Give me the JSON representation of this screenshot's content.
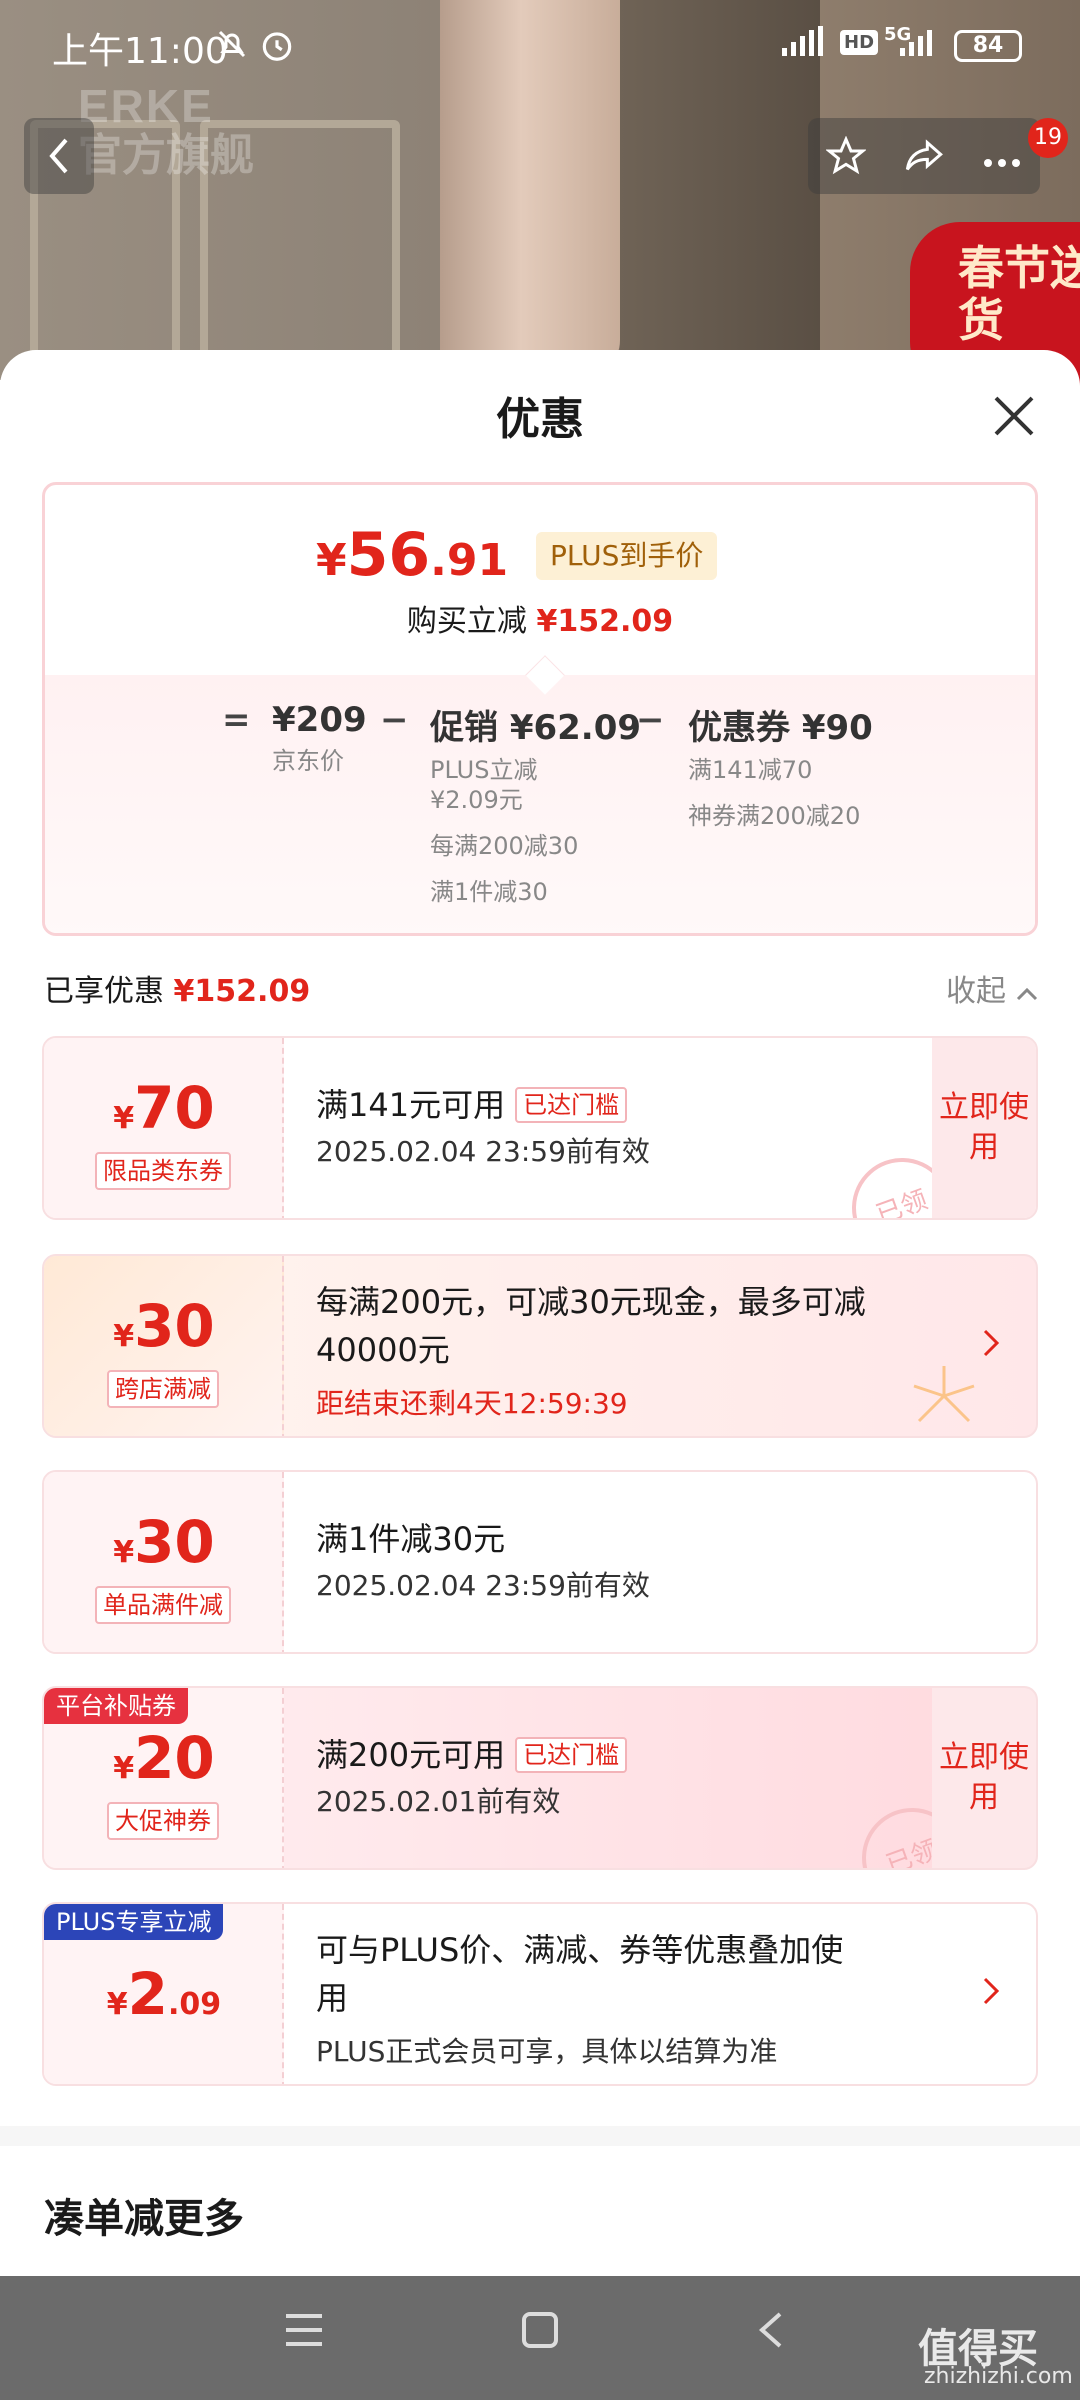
{
  "status_bar": {
    "time": "上午11:00",
    "mute_icon": "bell-off-icon",
    "alarm_icon": "alarm-icon",
    "signal": "5G",
    "hd": "HD",
    "battery": "84"
  },
  "background": {
    "logo_line1": "ERKE",
    "logo_line2": "官方旗舰",
    "sticker": "春节送货"
  },
  "nav": {
    "back_icon": "chevron-left-icon",
    "favorite_icon": "star-icon",
    "share_icon": "share-icon",
    "more_icon": "more-icon",
    "badge": "19"
  },
  "sheet": {
    "title": "优惠"
  },
  "summary": {
    "price_yen": "¥",
    "price_int": "56",
    "price_dec": ".91",
    "plus_tag": "PLUS到手价",
    "reduce_label": "购买立减",
    "reduce_value": "¥152.09",
    "eq": "=",
    "minus": "−",
    "jd_price": "¥209",
    "jd_label": "京东价",
    "promo_head": "促销 ¥62.09",
    "promo_items": [
      "PLUS立减",
      "¥2.09元",
      "每满200减30",
      "满1件减30"
    ],
    "coupon_head": "优惠券 ¥90",
    "coupon_items": [
      "满141减70",
      "神券满200减20"
    ]
  },
  "enjoyed": {
    "label": "已享优惠",
    "value": "¥152.09",
    "collapse": "收起"
  },
  "coupons": [
    {
      "yen": "¥",
      "amount": "70",
      "kind": "限品类东券",
      "title": "满141元可用",
      "tag": "已达门槛",
      "sub": "2025.02.04 23:59前有效",
      "action": "立即使用",
      "stamp": "已领"
    },
    {
      "yen": "¥",
      "amount": "30",
      "kind": "跨店满减",
      "title": "每满200元，可减30元现金，最多可减",
      "title2": "40000元",
      "sub": "距结束还剩4天12:59:39"
    },
    {
      "yen": "¥",
      "amount": "30",
      "kind": "单品满件减",
      "title": "满1件减30元",
      "sub": "2025.02.04 23:59前有效"
    },
    {
      "ribbon": "平台补贴券",
      "yen": "¥",
      "amount": "20",
      "kind": "大促神券",
      "title": "满200元可用",
      "tag": "已达门槛",
      "sub": "2025.02.01前有效",
      "action": "立即使用",
      "stamp": "已领"
    },
    {
      "ribbon": "PLUS专享立减",
      "yen": "¥",
      "amount": "2",
      "decimal": ".09",
      "title": "可与PLUS价、满减、券等优惠叠加使",
      "title2": "用",
      "sub": "PLUS正式会员可享，具体以结算为准"
    }
  ],
  "more_section": {
    "title": "凑单减更多"
  },
  "system_nav": {
    "menu_icon": "menu-icon",
    "home_icon": "home-square-icon",
    "back_icon": "back-triangle-icon"
  },
  "watermark": {
    "line1": "值得买",
    "line2": "zhizhizhi.com"
  },
  "colors": {
    "accent": "#e1251b",
    "plus_blue": "#2c45b8",
    "plus_gold": "#a0600a"
  }
}
